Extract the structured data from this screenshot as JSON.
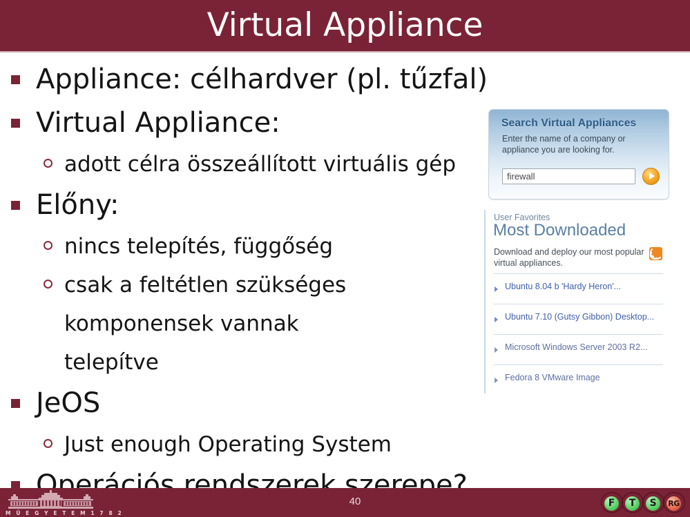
{
  "slide": {
    "title": "Virtual Appliance",
    "page_number": "40",
    "accent_color": "#7A2336",
    "title_text_color": "#FFFFFF",
    "body_text_color": "#141414"
  },
  "bullets": [
    {
      "level": 1,
      "text": "Appliance: célhardver (pl. tűzfal)",
      "marker": "square-bullet"
    },
    {
      "level": 1,
      "text": "Virtual Appliance:",
      "marker": "square-bullet"
    },
    {
      "level": 2,
      "text": "adott célra összeállított virtuális gép",
      "marker": "circle-bullet"
    },
    {
      "level": 1,
      "text": "Előny:",
      "marker": "square-bullet"
    },
    {
      "level": 2,
      "text": "nincs telepítés, függőség",
      "marker": "circle-bullet"
    },
    {
      "level": 2,
      "text": "csak a feltétlen szükséges komponensek vannak telepítve",
      "marker": "circle-bullet"
    },
    {
      "level": 1,
      "text": "JeOS",
      "marker": "square-bullet"
    },
    {
      "level": 2,
      "text": "Just enough Operating System",
      "marker": "circle-bullet"
    },
    {
      "level": 1,
      "text": "Operációs rendszerek szerepe?",
      "marker": "square-bullet"
    }
  ],
  "search_panel": {
    "title": "Search Virtual Appliances",
    "description": "Enter the name of a company or appliance you are looking for.",
    "input_value": "firewall",
    "input_placeholder": "firewall",
    "go_icon": "play-circle-icon",
    "gradient_top": "#8FB4D3",
    "gradient_bottom": "#FAFCFE",
    "title_color": "#2B5A86",
    "go_button_color": "#F5A623"
  },
  "downloads_panel": {
    "eyebrow": "User Favorites",
    "headline": "Most Downloaded",
    "blurb": "Download and deploy our most popular virtual appliances.",
    "rss_icon": "rss-feed-icon",
    "rss_color": "#EE8822",
    "link_color": "#3E5FA8",
    "items": [
      {
        "text": "Ubuntu 8.04 b 'Hardy Heron'...",
        "icon": "caret-right-icon",
        "dim": false
      },
      {
        "text": "Ubuntu 7.10 (Gutsy Gibbon) Desktop...",
        "icon": "caret-right-icon",
        "dim": false
      },
      {
        "text": "Microsoft Windows Server 2003 R2...",
        "icon": "caret-right-icon",
        "dim": true
      },
      {
        "text": "Fedora 8 VMware Image",
        "icon": "caret-right-icon",
        "dim": true
      }
    ]
  },
  "footer": {
    "university_logo_caption": "M Ű E G Y E T E M   1 7 8 2",
    "university_logo_icon": "university-building-icon",
    "research_group_logo_icon": "ftsrg-logo-icon",
    "research_group_nodes": [
      "F",
      "T",
      "S",
      "RG"
    ]
  }
}
